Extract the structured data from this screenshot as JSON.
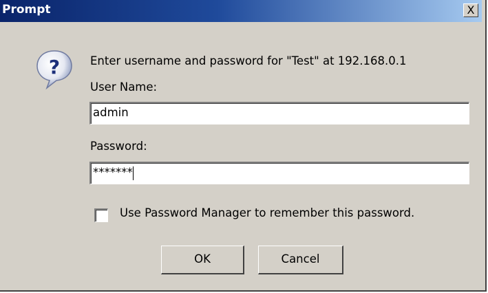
{
  "window": {
    "title": "Prompt",
    "close_label": "X"
  },
  "icon": "question-icon",
  "message": "Enter username and password for \"Test\" at 192.168.0.1",
  "username": {
    "label": "User Name:",
    "value": "admin"
  },
  "password": {
    "label": "Password:",
    "value": "*******"
  },
  "remember": {
    "label": "Use Password Manager to remember this password.",
    "checked": false
  },
  "buttons": {
    "ok": "OK",
    "cancel": "Cancel"
  },
  "colors": {
    "titlebar_start": "#0a246a",
    "titlebar_end": "#a6caf0",
    "dialog_bg": "#d4d0c8"
  }
}
